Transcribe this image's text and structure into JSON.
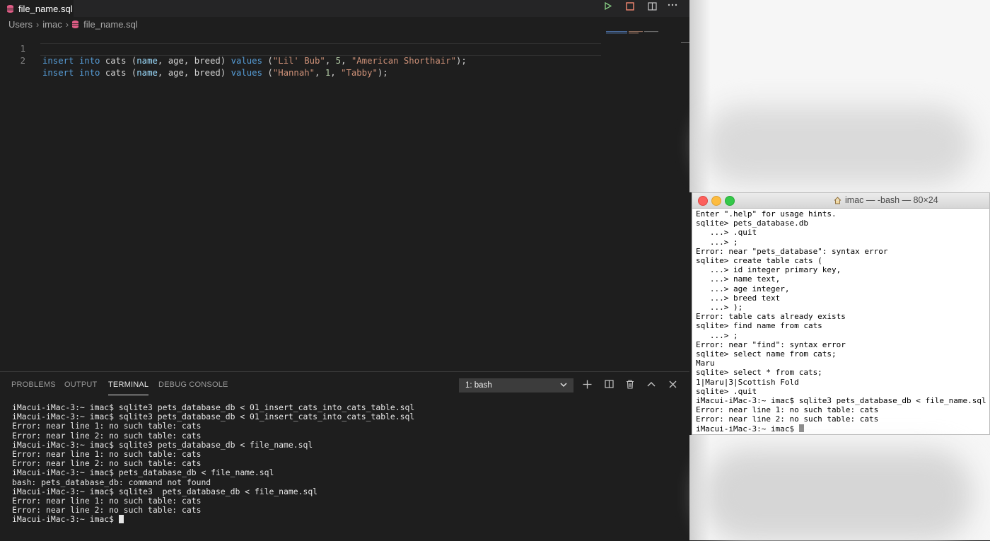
{
  "editor": {
    "tab_label": "file_name.sql",
    "breadcrumb": [
      "Users",
      "imac",
      "file_name.sql"
    ],
    "lines": [
      {
        "num": "1",
        "tokens": [
          {
            "t": "insert",
            "c": "kw"
          },
          {
            "t": " ",
            "c": ""
          },
          {
            "t": "into",
            "c": "kw"
          },
          {
            "t": " cats (",
            "c": ""
          },
          {
            "t": "name",
            "c": "id"
          },
          {
            "t": ", age, breed) ",
            "c": ""
          },
          {
            "t": "values",
            "c": "kw"
          },
          {
            "t": " (",
            "c": ""
          },
          {
            "t": "\"Lil' Bub\"",
            "c": "str"
          },
          {
            "t": ", ",
            "c": ""
          },
          {
            "t": "5",
            "c": "num"
          },
          {
            "t": ", ",
            "c": ""
          },
          {
            "t": "\"American Shorthair\"",
            "c": "str"
          },
          {
            "t": ");",
            "c": ""
          }
        ]
      },
      {
        "num": "2",
        "tokens": [
          {
            "t": "insert",
            "c": "kw"
          },
          {
            "t": " ",
            "c": ""
          },
          {
            "t": "into",
            "c": "kw"
          },
          {
            "t": " cats (",
            "c": ""
          },
          {
            "t": "name",
            "c": "id"
          },
          {
            "t": ", age, breed) ",
            "c": ""
          },
          {
            "t": "values",
            "c": "kw"
          },
          {
            "t": " (",
            "c": ""
          },
          {
            "t": "\"Hannah\"",
            "c": "str"
          },
          {
            "t": ", ",
            "c": ""
          },
          {
            "t": "1",
            "c": "num"
          },
          {
            "t": ", ",
            "c": ""
          },
          {
            "t": "\"Tabby\"",
            "c": "str"
          },
          {
            "t": ");",
            "c": ""
          }
        ]
      }
    ]
  },
  "toolbar": {
    "run_icon": "play-icon",
    "stop_icon": "stop-icon",
    "split_icon": "split-editor-icon",
    "more_icon": "ellipsis-icon"
  },
  "panel": {
    "tabs": [
      "PROBLEMS",
      "OUTPUT",
      "TERMINAL",
      "DEBUG CONSOLE"
    ],
    "active_tab": "TERMINAL",
    "terminal_select": "1: bash",
    "terminal_lines": [
      "iMacui-iMac-3:~ imac$ sqlite3 pets_database_db < 01_insert_cats_into_cats_table.sql",
      "iMacui-iMac-3:~ imac$ sqlite3 pets_database_db < 01_insert_cats_into_cats_table.sql",
      "Error: near line 1: no such table: cats",
      "Error: near line 2: no such table: cats",
      "iMacui-iMac-3:~ imac$ sqlite3 pets_database_db < file_name.sql",
      "Error: near line 1: no such table: cats",
      "Error: near line 2: no such table: cats",
      "iMacui-iMac-3:~ imac$ pets_database_db < file_name.sql",
      "bash: pets_database_db: command not found",
      "iMacui-iMac-3:~ imac$ sqlite3  pets_database_db < file_name.sql",
      "Error: near line 1: no such table: cats",
      "Error: near line 2: no such table: cats"
    ],
    "terminal_prompt": "iMacui-iMac-3:~ imac$ "
  },
  "mac_terminal": {
    "title": "imac — -bash — 80×24",
    "lines": [
      "Enter \".help\" for usage hints.",
      "sqlite> pets_database.db",
      "   ...> .quit",
      "   ...> ;",
      "Error: near \"pets_database\": syntax error",
      "sqlite> create table cats (",
      "   ...> id integer primary key,",
      "   ...> name text,",
      "   ...> age integer,",
      "   ...> breed text",
      "   ...> );",
      "Error: table cats already exists",
      "sqlite> find name from cats",
      "   ...> ;",
      "Error: near \"find\": syntax error",
      "sqlite> select name from cats;",
      "Maru",
      "sqlite> select * from cats;",
      "1|Maru|3|Scottish Fold",
      "sqlite> .quit",
      "iMacui-iMac-3:~ imac$ sqlite3 pets_database_db < file_name.sql",
      "Error: near line 1: no such table: cats",
      "Error: near line 2: no such table: cats"
    ],
    "prompt": "iMacui-iMac-3:~ imac$ "
  },
  "colors": {
    "keyword": "#569cd6",
    "string": "#ce9178",
    "number": "#b5cea8",
    "identifier": "#9cdcfe",
    "run": "#89d185",
    "stop": "#f48771",
    "sql_icon": "#e05d86"
  }
}
